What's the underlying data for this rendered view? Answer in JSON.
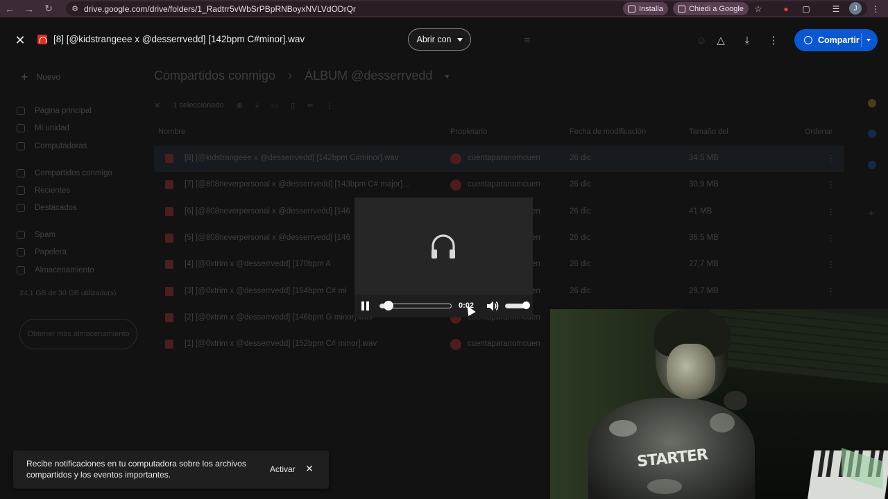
{
  "browser": {
    "url": "drive.google.com/drive/folders/1_Radtrr5vWbSrPBpRNBoyxNVLVdODrQr",
    "install_label": "Installa",
    "ask_google_label": "Chiedi a Google",
    "profile_initial": "J"
  },
  "viewer": {
    "file_title": "[8] [@kidstrangeee x @desserrvedd] [142bpm C#minor].wav",
    "open_with_label": "Abrir con",
    "share_label": "Compartir"
  },
  "drive": {
    "new_label": "Nuevo",
    "sidebar": [
      {
        "label": "Página principal",
        "icon": "home-icon"
      },
      {
        "label": "Mi unidad",
        "icon": "drive-icon"
      },
      {
        "label": "Computadoras",
        "icon": "computer-icon"
      },
      {
        "label": "Compartidos conmigo",
        "icon": "people-icon"
      },
      {
        "label": "Recientes",
        "icon": "clock-icon"
      },
      {
        "label": "Destacados",
        "icon": "star-icon"
      },
      {
        "label": "Spam",
        "icon": "spam-icon"
      },
      {
        "label": "Papelera",
        "icon": "trash-icon"
      },
      {
        "label": "Almacenamiento",
        "icon": "cloud-icon"
      }
    ],
    "storage_text": "24,1 GB de 30 GB utilizado(s)",
    "storage_button": "Obtener más almacenamiento",
    "breadcrumb": [
      "Compartidos conmigo",
      "ÁLBUM @desserrvedd"
    ],
    "selection_label": "1 seleccionado",
    "columns": {
      "name": "Nombre",
      "owner": "Propietario",
      "modified": "Fecha de modificación",
      "size": "Tamaño del",
      "sort": "Ordenar"
    },
    "files": [
      {
        "name": "[8] [@kidstrangeee x @desserrvedd] [142bpm C#minor].wav",
        "owner": "cuentaparanomcuen",
        "date": "26 dic",
        "size": "34,5 MB"
      },
      {
        "name": "[7] [@808neverpersonal x @desserrvedd] [143bpm C# major]...",
        "owner": "cuentaparanomcuen",
        "date": "26 dic",
        "size": "30,9 MB"
      },
      {
        "name": "[6] [@808neverpersonal x @desserrvedd] [146",
        "owner": "cuentaparanomcuen",
        "date": "26 dic",
        "size": "41 MB"
      },
      {
        "name": "[5] [@808neverpersonal x @desserrvedd] [146",
        "owner": "cuentaparanomcuen",
        "date": "26 dic",
        "size": "36,5 MB"
      },
      {
        "name": "[4] [@0xtrim x @desserrvedd] [170bpm A",
        "owner": "cuentaparanomcuen",
        "date": "26 dic",
        "size": "27,7 MB"
      },
      {
        "name": "[3] [@0xtrim x @desserrvedd] [164bpm C# mi",
        "owner": "cuentaparanomcuen",
        "date": "26 dic",
        "size": "29,7 MB"
      },
      {
        "name": "[2] [@0xtrim x @desserrvedd] [146bpm G minor].wav",
        "owner": "cuentaparanomcuen",
        "date": "26 dic",
        "size": ""
      },
      {
        "name": "[1] [@0xtrim x @desserrvedd] [152bpm C# minor].wav",
        "owner": "cuentaparanomcuen",
        "date": "",
        "size": ""
      }
    ]
  },
  "player": {
    "time": "0:02",
    "progress": 0.07,
    "volume": 1.0,
    "icon": "headphones-icon"
  },
  "toast": {
    "message": "Recibe notificaciones en tu computadora sobre los archivos compartidos y los eventos importantes.",
    "action_label": "Activar"
  },
  "webcam": {
    "shirt_text": "STARTER"
  }
}
